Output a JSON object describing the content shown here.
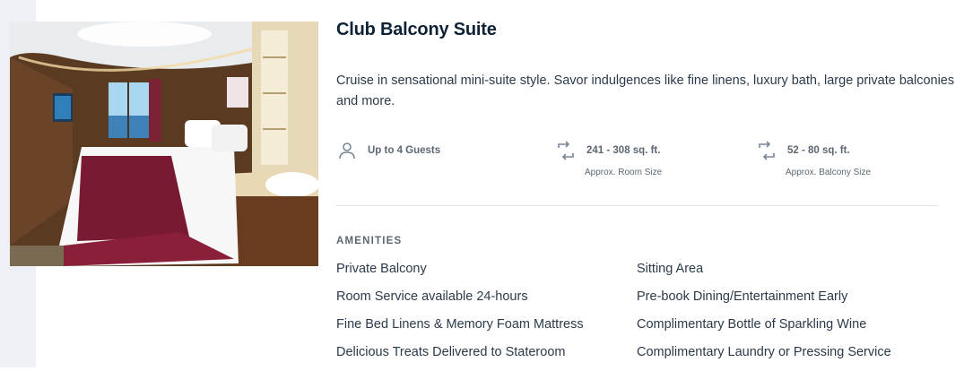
{
  "suite": {
    "title": "Club Balcony Suite",
    "description": "Cruise in sensational mini-suite style. Savor indulgences like fine linens, luxury bath, large private balconies and more."
  },
  "specs": {
    "guests": {
      "label": "Up to 4 Guests",
      "icon": "person-icon"
    },
    "room": {
      "label": "241 - 308 sq. ft.",
      "sub": "Approx. Room Size",
      "icon": "resize-arrows-icon"
    },
    "balcony": {
      "label": "52 - 80 sq. ft.",
      "sub": "Approx. Balcony Size",
      "icon": "resize-arrows-icon"
    }
  },
  "amenities": {
    "heading": "AMENITIES",
    "left": [
      "Private Balcony",
      "Room Service available 24-hours",
      "Fine Bed Linens & Memory Foam Mattress",
      "Delicious Treats Delivered to Stateroom"
    ],
    "right": [
      "Sitting Area",
      "Pre-book Dining/Entertainment Early",
      "Complimentary Bottle of Sparkling Wine",
      "Complimentary Laundry or Pressing Service"
    ]
  },
  "colors": {
    "title": "#0d2235",
    "text": "#2b3a4b",
    "muted": "#5c6773",
    "strip": "#edf1f5",
    "bedspread": "#7a1a32"
  }
}
